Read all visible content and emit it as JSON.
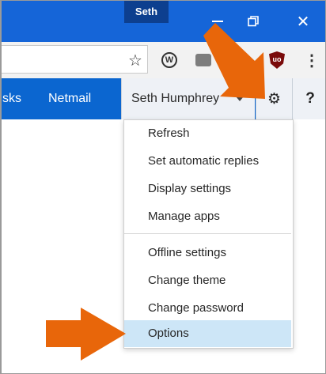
{
  "browser": {
    "profile_name": "Seth",
    "window_controls": {
      "minimize": "—",
      "restore": "❐",
      "close": "✕"
    },
    "toolbar": {
      "bookmark_icon": "star-icon",
      "extensions": [
        "w-extension-icon",
        "rss-extension-icon",
        "gray-extension-icon",
        "ublock-shield-icon"
      ],
      "ublock_text": "uo",
      "menu_icon": "⋮"
    }
  },
  "outlook": {
    "nav_links": [
      "sks",
      "Netmail"
    ],
    "user_name": "Seth Humphrey",
    "gear_glyph": "⚙",
    "help_label": "?"
  },
  "settings_menu": {
    "items": [
      "Refresh",
      "Set automatic replies",
      "Display settings",
      "Manage apps",
      "Offline settings",
      "Change theme",
      "Change password",
      "Options"
    ],
    "selected": "Options"
  },
  "annotations": {
    "arrow_color": "#e8660a"
  },
  "colors": {
    "titlebar": "#1565d8",
    "navbar": "#0b66d0",
    "selected_item": "#cde6f7"
  }
}
